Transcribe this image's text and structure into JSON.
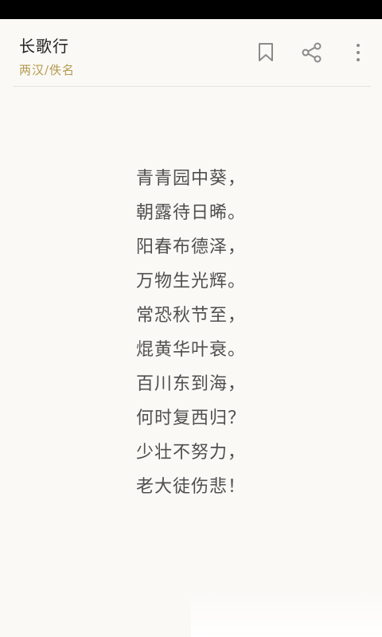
{
  "header": {
    "title": "长歌行",
    "subtitle": "两汉/佚名"
  },
  "actions": {
    "bookmark_icon": "bookmark-icon",
    "share_icon": "share-icon",
    "more_icon": "more-vertical-icon"
  },
  "poem": {
    "lines": [
      "青青园中葵，",
      "朝露待日晞。",
      "阳春布德泽，",
      "万物生光辉。",
      "常恐秋节至，",
      "焜黄华叶衰。",
      "百川东到海，",
      "何时复西归？",
      "少壮不努力，",
      "老大徒伤悲！"
    ]
  },
  "colors": {
    "background": "#faf9f6",
    "title": "#222222",
    "subtitle": "#b59a4d",
    "poem_text": "#4f4f4f",
    "icon": "#8a8a8a"
  }
}
